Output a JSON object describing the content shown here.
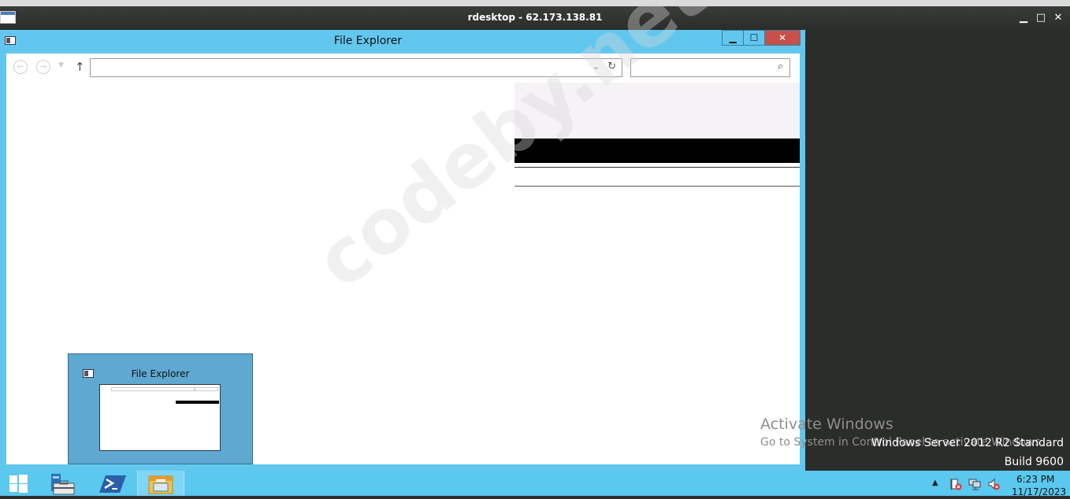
{
  "rdp": {
    "title": "rdesktop - 62.173.138.81",
    "minimize_label": "▁",
    "maximize_label": "□",
    "close_label": "✕"
  },
  "explorer": {
    "title": "File Explorer",
    "minimize_label": "▁",
    "maximize_label": "☐",
    "close_label": "✕",
    "address": {
      "value": "",
      "placeholder": ""
    },
    "search": {
      "value": "",
      "placeholder": ""
    }
  },
  "task_switch": {
    "title": "File Explorer"
  },
  "watermark": "codeby.net",
  "activation": {
    "title": "Activate Windows",
    "subtitle": "Go to System in Control Panel to activate Windows."
  },
  "os": {
    "edition": "Windows Server 2012 R2 Standard",
    "build": "Build 9600"
  },
  "taskbar": {
    "time": "6:23 PM",
    "date": "11/17/2023"
  },
  "colors": {
    "window_frame": "#62c7ef",
    "close_button": "#c7504a",
    "taskbar": "#5ac8ef",
    "host_background": "#2b2d2a"
  },
  "icons": [
    "app-icon",
    "system-menu-icon",
    "back-arrow-icon",
    "forward-arrow-icon",
    "up-arrow-icon",
    "chevron-down-icon",
    "refresh-icon",
    "search-icon",
    "windows-logo-icon",
    "server-manager-icon",
    "powershell-icon",
    "file-explorer-icon",
    "action-center-icon",
    "network-icon",
    "volume-icon"
  ]
}
